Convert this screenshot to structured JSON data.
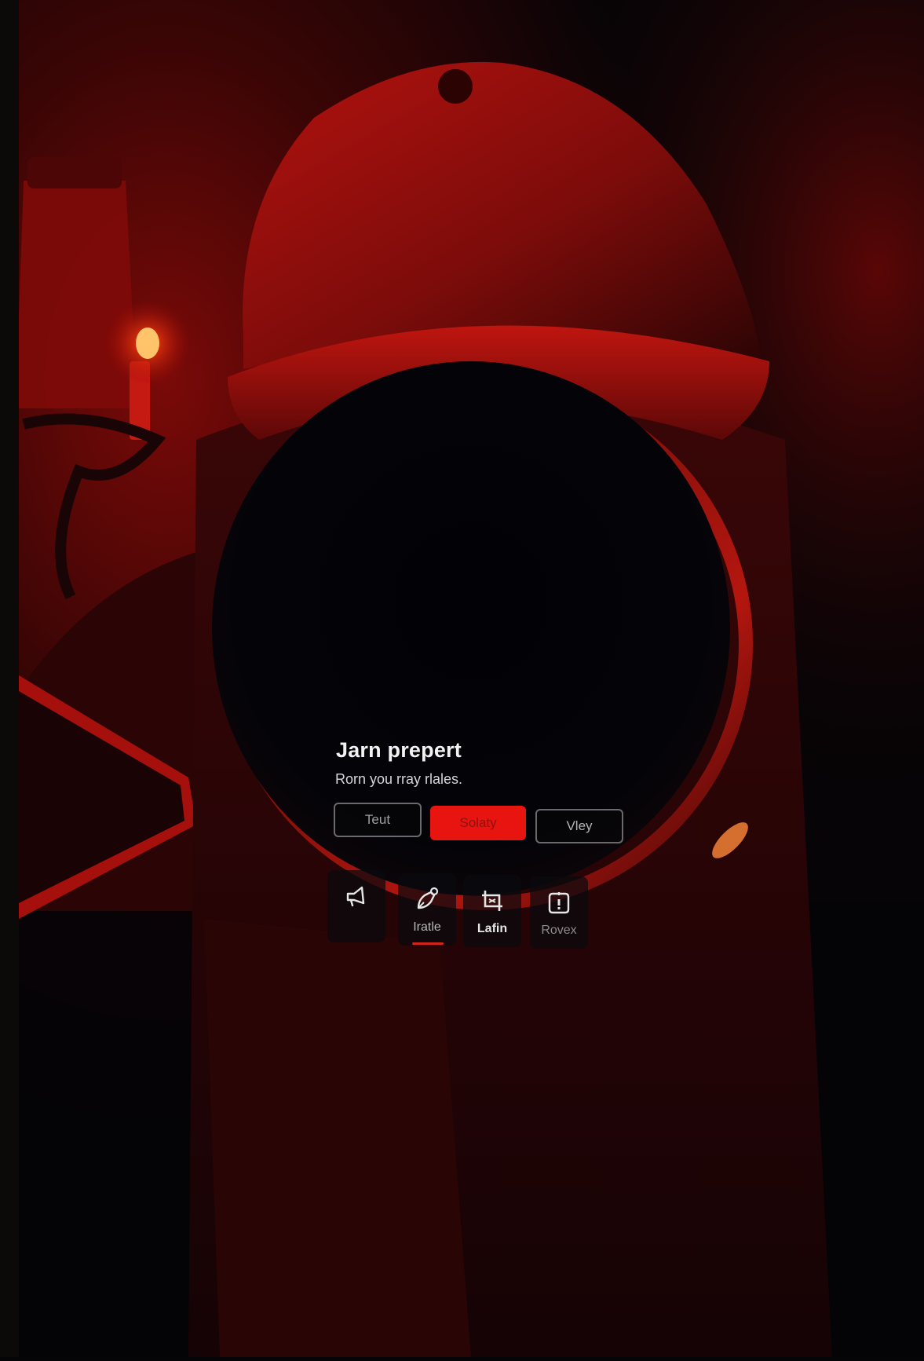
{
  "dialog": {
    "title": "Jarn prepert",
    "subtitle": "Rorn you rray rlales.",
    "buttons": [
      {
        "label": "Teut"
      },
      {
        "label": "Solaty"
      },
      {
        "label": "Vley"
      }
    ]
  },
  "toolbar": {
    "items": [
      {
        "icon": "megaphone-icon",
        "label": ""
      },
      {
        "icon": "pen-nib-icon",
        "label": "Iratle"
      },
      {
        "icon": "crop-icon",
        "label": "Lafin"
      },
      {
        "icon": "alert-box-icon",
        "label": "Rovex"
      }
    ]
  },
  "colors": {
    "accent": "#e8140f",
    "background": "#050507",
    "scene_red": "#b3120f"
  }
}
